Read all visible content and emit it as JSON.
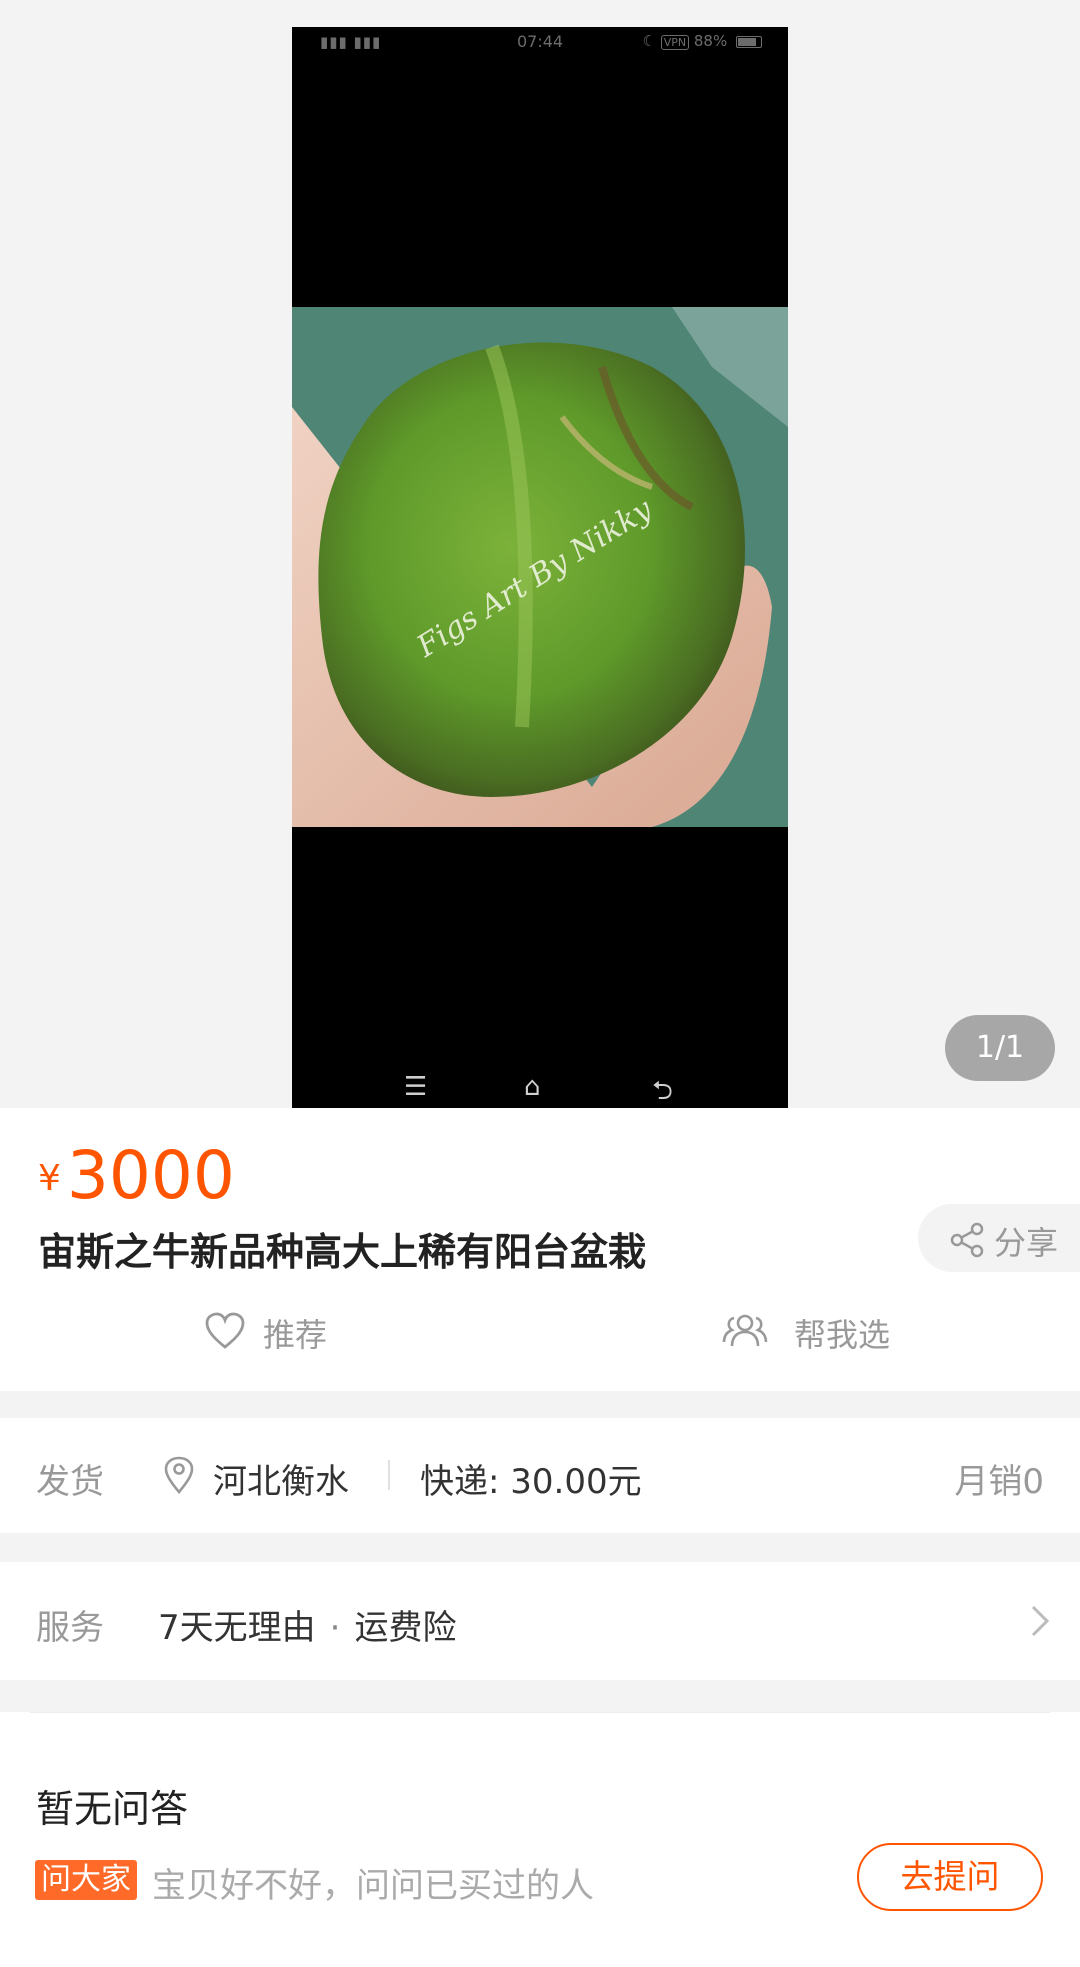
{
  "gallery": {
    "counter": "1/1",
    "screenshot": {
      "status": {
        "time": "07:44",
        "battery": "88%",
        "vpn": "VPN"
      },
      "watermark": "Figs Art By Nikky",
      "nav": {
        "menu": "☰",
        "home": "⌂",
        "back": "⮌"
      }
    }
  },
  "product": {
    "currency": "¥",
    "price": "3000",
    "title": "宙斯之牛新品种高大上稀有阳台盆栽",
    "share_label": "分享",
    "recommend_label": "推荐",
    "help_choose_label": "帮我选"
  },
  "shipping": {
    "label": "发货",
    "location": "河北衡水",
    "fee": "快递: 30.00元",
    "monthly_sales": "月销0"
  },
  "service": {
    "label": "服务",
    "items": [
      "7天无理由",
      "运费险"
    ],
    "separator": "·"
  },
  "qa": {
    "title": "暂无问答",
    "badge": "问大家",
    "hint": "宝贝好不好，问问已买过的人",
    "ask_button": "去提问"
  },
  "colors": {
    "accent": "#ff5500",
    "badge": "#ff6a28",
    "muted": "#999999"
  }
}
